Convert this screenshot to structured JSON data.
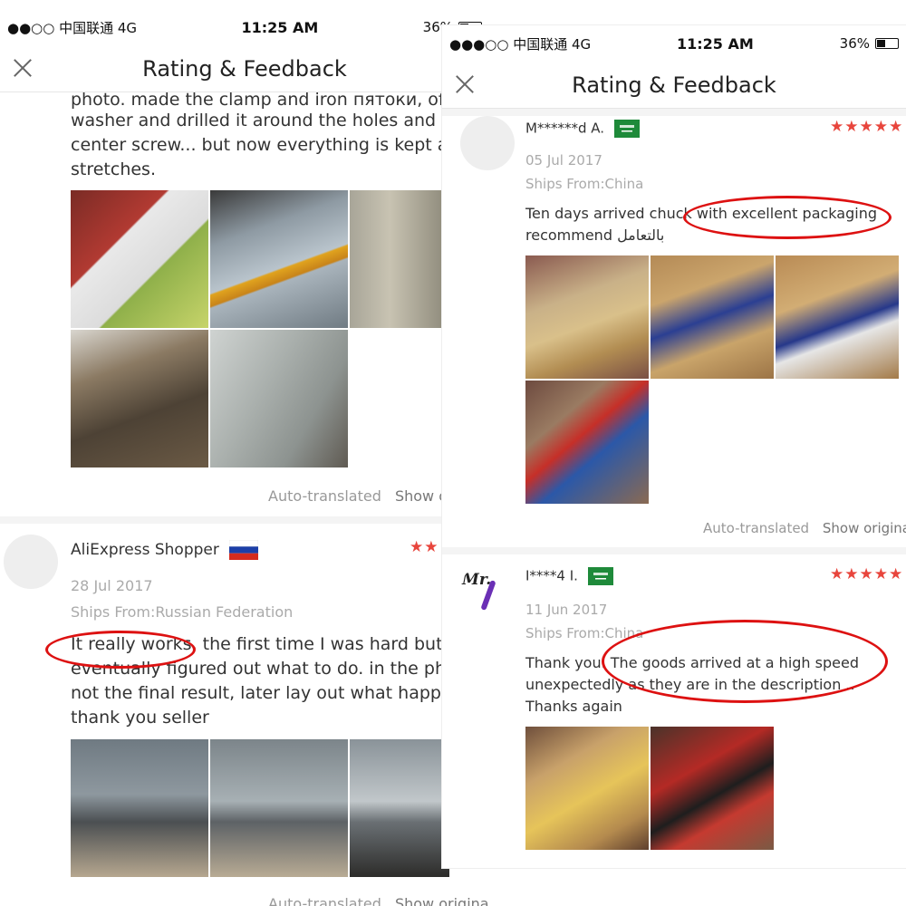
{
  "left": {
    "status": {
      "carrier": "●●○○ 中国联通  4G",
      "time": "11:25 AM",
      "battery": "36%",
      "battery_level": 0.36
    },
    "nav": {
      "title": "Rating & Feedback"
    },
    "prev_review": {
      "text_lines": [
        "photo. made the clamp and iron пятоки, of t",
        "washer and drilled it around the holes and th",
        "center screw... but now everything is kept and",
        "stretches."
      ],
      "auto_translated": "Auto-translated",
      "show_original": "Show o"
    },
    "review": {
      "name": "AliExpress Shopper",
      "stars": "★★",
      "date": "28 Jul 2017",
      "ships": "Ships From:Russian Federation",
      "text_lines": [
        "It really works, the first time I was hard but",
        "eventually figured out what to do. in the phot",
        "not the final result, later lay out what happen",
        "thank you seller"
      ],
      "auto_translated": "Auto-translated",
      "show_original": "Show original"
    }
  },
  "right": {
    "status": {
      "carrier": "●●●○○ 中国联通  4G",
      "time": "11:25 AM",
      "battery": "36%",
      "battery_level": 0.36
    },
    "nav": {
      "title": "Rating & Feedback"
    },
    "review1": {
      "name": "M******d A.",
      "stars": "★★★★★",
      "date": "05 Jul 2017",
      "ships": "Ships From:China",
      "text_lines": [
        "Ten days arrived chuck with excellent packaging",
        "recommend بالتعامل"
      ],
      "auto_translated": "Auto-translated",
      "show_original": "Show original"
    },
    "review2": {
      "name": "I****4 I.",
      "stars": "★★★★★",
      "date": "11 Jun 2017",
      "ships": "Ships From:China",
      "text_lines": [
        "Thank you. The goods arrived at a high speed",
        "unexpectedly as they are in the description ..",
        "Thanks again"
      ],
      "avatar_text": "Mr."
    }
  },
  "colors": {
    "accent_red": "#e8453c",
    "highlight_ellipse": "#d11111"
  }
}
